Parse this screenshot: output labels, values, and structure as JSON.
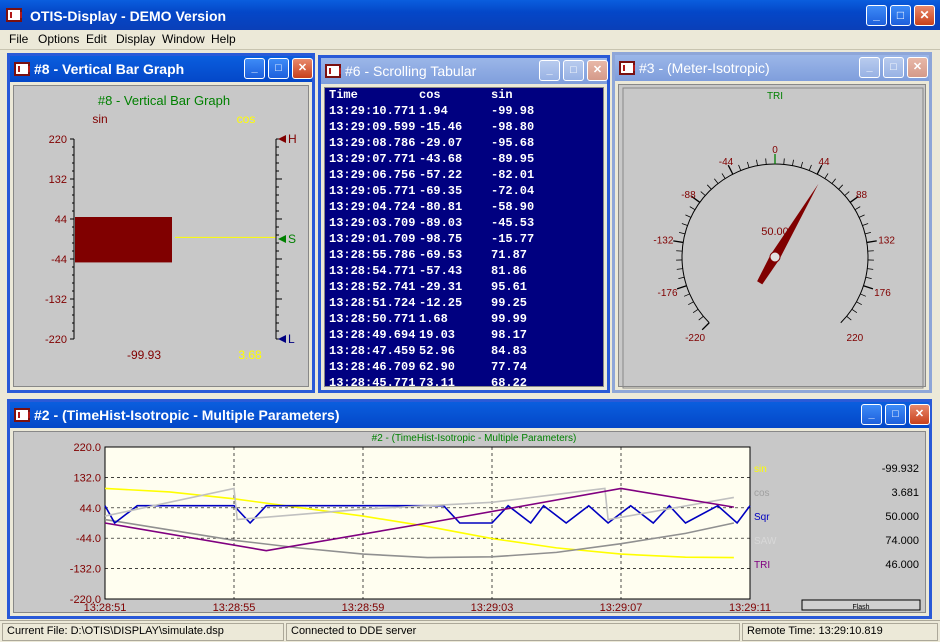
{
  "app": {
    "title": "OTIS-Display - DEMO Version"
  },
  "menu": [
    "File",
    "Options",
    "Edit",
    "Display",
    "Window",
    "Help"
  ],
  "bar_window": {
    "title": "#8 - Vertical Bar Graph",
    "inner_title": "#8 - Vertical Bar Graph",
    "left_label": "sin",
    "right_label": "cos",
    "ticks": [
      "220",
      "132",
      "44",
      "-44",
      "-132",
      "-220"
    ],
    "markers": [
      "H",
      "S",
      "L"
    ],
    "sin_value": "-99.93",
    "cos_value": "3.68",
    "sin_numeric": -99.93,
    "cos_numeric": 3.68,
    "colors": {
      "sin": "#800000",
      "cos": "#ffff00",
      "title": "#008000"
    }
  },
  "tabular_window": {
    "title": "#6 - Scrolling Tabular",
    "headers": [
      "Time",
      "cos",
      "sin"
    ],
    "rows": [
      [
        "13:29:10.771",
        "1.94",
        "-99.98"
      ],
      [
        "13:29:09.599",
        "-15.46",
        "-98.80"
      ],
      [
        "13:29:08.786",
        "-29.07",
        "-95.68"
      ],
      [
        "13:29:07.771",
        "-43.68",
        "-89.95"
      ],
      [
        "13:29:06.756",
        "-57.22",
        "-82.01"
      ],
      [
        "13:29:05.771",
        "-69.35",
        "-72.04"
      ],
      [
        "13:29:04.724",
        "-80.81",
        "-58.90"
      ],
      [
        "13:29:03.709",
        "-89.03",
        "-45.53"
      ],
      [
        "13:29:01.709",
        "-98.75",
        "-15.77"
      ],
      [
        "13:28:55.786",
        "-69.53",
        "71.87"
      ],
      [
        "13:28:54.771",
        "-57.43",
        "81.86"
      ],
      [
        "13:28:52.741",
        "-29.31",
        "95.61"
      ],
      [
        "13:28:51.724",
        "-12.25",
        "99.25"
      ],
      [
        "13:28:50.771",
        "1.68",
        "99.99"
      ],
      [
        "13:28:49.694",
        "19.03",
        "98.17"
      ],
      [
        "13:28:47.459",
        "52.96",
        "84.83"
      ],
      [
        "13:28:46.709",
        "62.90",
        "77.74"
      ],
      [
        "13:28:45.771",
        "73.11",
        "68.22"
      ]
    ]
  },
  "meter_window": {
    "title": "#3 - (Meter-Isotropic)",
    "label": "TRI",
    "value": "50.00",
    "value_numeric": 50,
    "scale_labels": [
      "-220",
      "-176",
      "-132",
      "-88",
      "-44",
      "0",
      "44",
      "88",
      "132",
      "176",
      "220"
    ]
  },
  "timehist_window": {
    "title": "#2 - (TimeHist-Isotropic - Multiple Parameters)",
    "inner_title": "#2 - (TimeHist-Isotropic - Multiple Parameters)",
    "button_label": "Flash",
    "legend": [
      {
        "name": "sin",
        "value": "-99.932",
        "color": "#ffff00"
      },
      {
        "name": "cos",
        "value": "3.681",
        "color": "#a0a0a0"
      },
      {
        "name": "Sqr",
        "value": "50.000",
        "color": "#0000c0"
      },
      {
        "name": "SAW",
        "value": "74.000",
        "color": "#d8d8d8"
      },
      {
        "name": "TRI",
        "value": "46.000",
        "color": "#800080"
      }
    ]
  },
  "chart_data": {
    "type": "line",
    "title": "#2 - (TimeHist-Isotropic - Multiple Parameters)",
    "y_ticks": [
      "220.0",
      "132.0",
      "44.0",
      "-44.0",
      "-132.0",
      "-220.0"
    ],
    "x_ticks": [
      "13:28:51",
      "13:28:55",
      "13:28:59",
      "13:29:03",
      "13:29:07",
      "13:29:11"
    ],
    "ylim": [
      -220,
      220
    ],
    "xlim": [
      0,
      20
    ],
    "grid": true,
    "legend_position": "right",
    "series": [
      {
        "name": "sin",
        "color": "#ffff00",
        "x": [
          0,
          2,
          4,
          6,
          8,
          10,
          12,
          14,
          16,
          18,
          19.5
        ],
        "y": [
          100,
          90,
          70,
          45,
          20,
          -10,
          -45,
          -72,
          -90,
          -99,
          -100
        ]
      },
      {
        "name": "cos",
        "color": "#909090",
        "x": [
          0,
          2,
          4,
          6,
          8,
          10,
          12,
          14,
          16,
          18,
          19.5
        ],
        "y": [
          10,
          -20,
          -50,
          -72,
          -90,
          -100,
          -98,
          -85,
          -60,
          -30,
          0
        ]
      },
      {
        "name": "Sqr",
        "color": "#0000c0",
        "x": [
          0,
          0.3,
          1,
          4,
          4.5,
          5,
          10.5,
          11,
          12,
          12.5,
          13.2,
          13.6,
          14.3,
          15,
          15.6,
          16.3,
          17,
          17.5,
          18,
          19,
          19.6,
          20
        ],
        "y": [
          50,
          0,
          50,
          50,
          0,
          50,
          50,
          0,
          0,
          50,
          0,
          50,
          0,
          50,
          0,
          50,
          0,
          50,
          0,
          50,
          0,
          50
        ]
      },
      {
        "name": "SAW",
        "color": "#c0c0c0",
        "x": [
          0,
          4,
          4.1,
          8,
          12,
          15.5,
          15.6,
          19.5
        ],
        "y": [
          20,
          100,
          10,
          40,
          60,
          100,
          10,
          74
        ]
      },
      {
        "name": "TRI",
        "color": "#800080",
        "x": [
          0,
          5,
          10,
          16,
          19.5
        ],
        "y": [
          0,
          -80,
          0,
          100,
          46
        ]
      }
    ]
  },
  "statusbar": {
    "file": "Current File: D:\\OTIS\\DISPLAY\\simulate.dsp",
    "connection": "Connected to DDE server",
    "remote_time": "Remote Time: 13:29:10.819"
  }
}
